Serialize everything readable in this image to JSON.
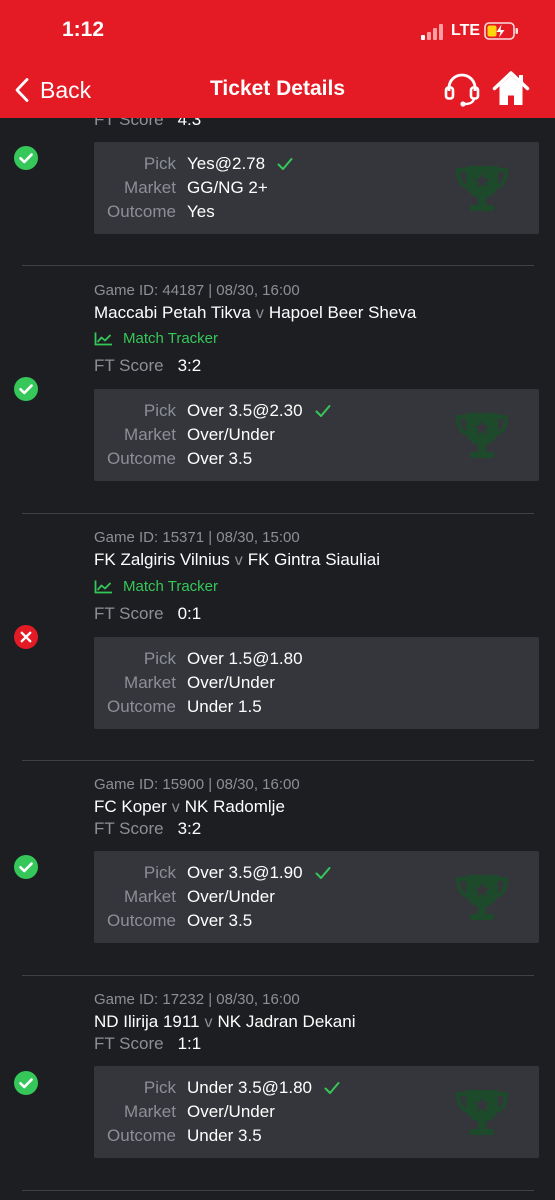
{
  "status_bar": {
    "time": "1:12",
    "network": "LTE"
  },
  "nav": {
    "back_label": "Back",
    "title": "Ticket Details"
  },
  "labels": {
    "pick": "Pick",
    "market": "Market",
    "outcome": "Outcome",
    "ft_score": "FT Score",
    "match_tracker": "Match Tracker",
    "vs": "v"
  },
  "colors": {
    "brand_red": "#e41b24",
    "background": "#1d1e22",
    "card": "#35363b",
    "win_green": "#35c759",
    "loss_red": "#e41b24",
    "muted_text": "#8d8f96"
  },
  "bets": [
    {
      "status": "won",
      "meta": "",
      "home": "",
      "away": "",
      "tracker": false,
      "score": "4:3",
      "pick": "Yes@2.78",
      "market": "GG/NG 2+",
      "outcome": "Yes",
      "partial_top": true
    },
    {
      "status": "won",
      "meta": "Game ID: 44187 | 08/30, 16:00",
      "home": "Maccabi Petah Tikva",
      "away": "Hapoel Beer Sheva",
      "tracker": true,
      "score": "3:2",
      "pick": "Over 3.5@2.30",
      "market": "Over/Under",
      "outcome": "Over 3.5"
    },
    {
      "status": "lost",
      "meta": "Game ID: 15371 | 08/30, 15:00",
      "home": "FK Zalgiris Vilnius",
      "away": "FK Gintra Siauliai",
      "tracker": true,
      "score": "0:1",
      "pick": "Over 1.5@1.80",
      "market": "Over/Under",
      "outcome": "Under 1.5"
    },
    {
      "status": "won",
      "meta": "Game ID: 15900 | 08/30, 16:00",
      "home": "FC Koper",
      "away": "NK Radomlje",
      "tracker": false,
      "score": "3:2",
      "pick": "Over 3.5@1.90",
      "market": "Over/Under",
      "outcome": "Over 3.5"
    },
    {
      "status": "won",
      "meta": "Game ID: 17232 | 08/30, 16:00",
      "home": "ND Ilirija 1911",
      "away": "NK Jadran Dekani",
      "tracker": false,
      "score": "1:1",
      "pick": "Under 3.5@1.80",
      "market": "Over/Under",
      "outcome": "Under 3.5"
    }
  ]
}
